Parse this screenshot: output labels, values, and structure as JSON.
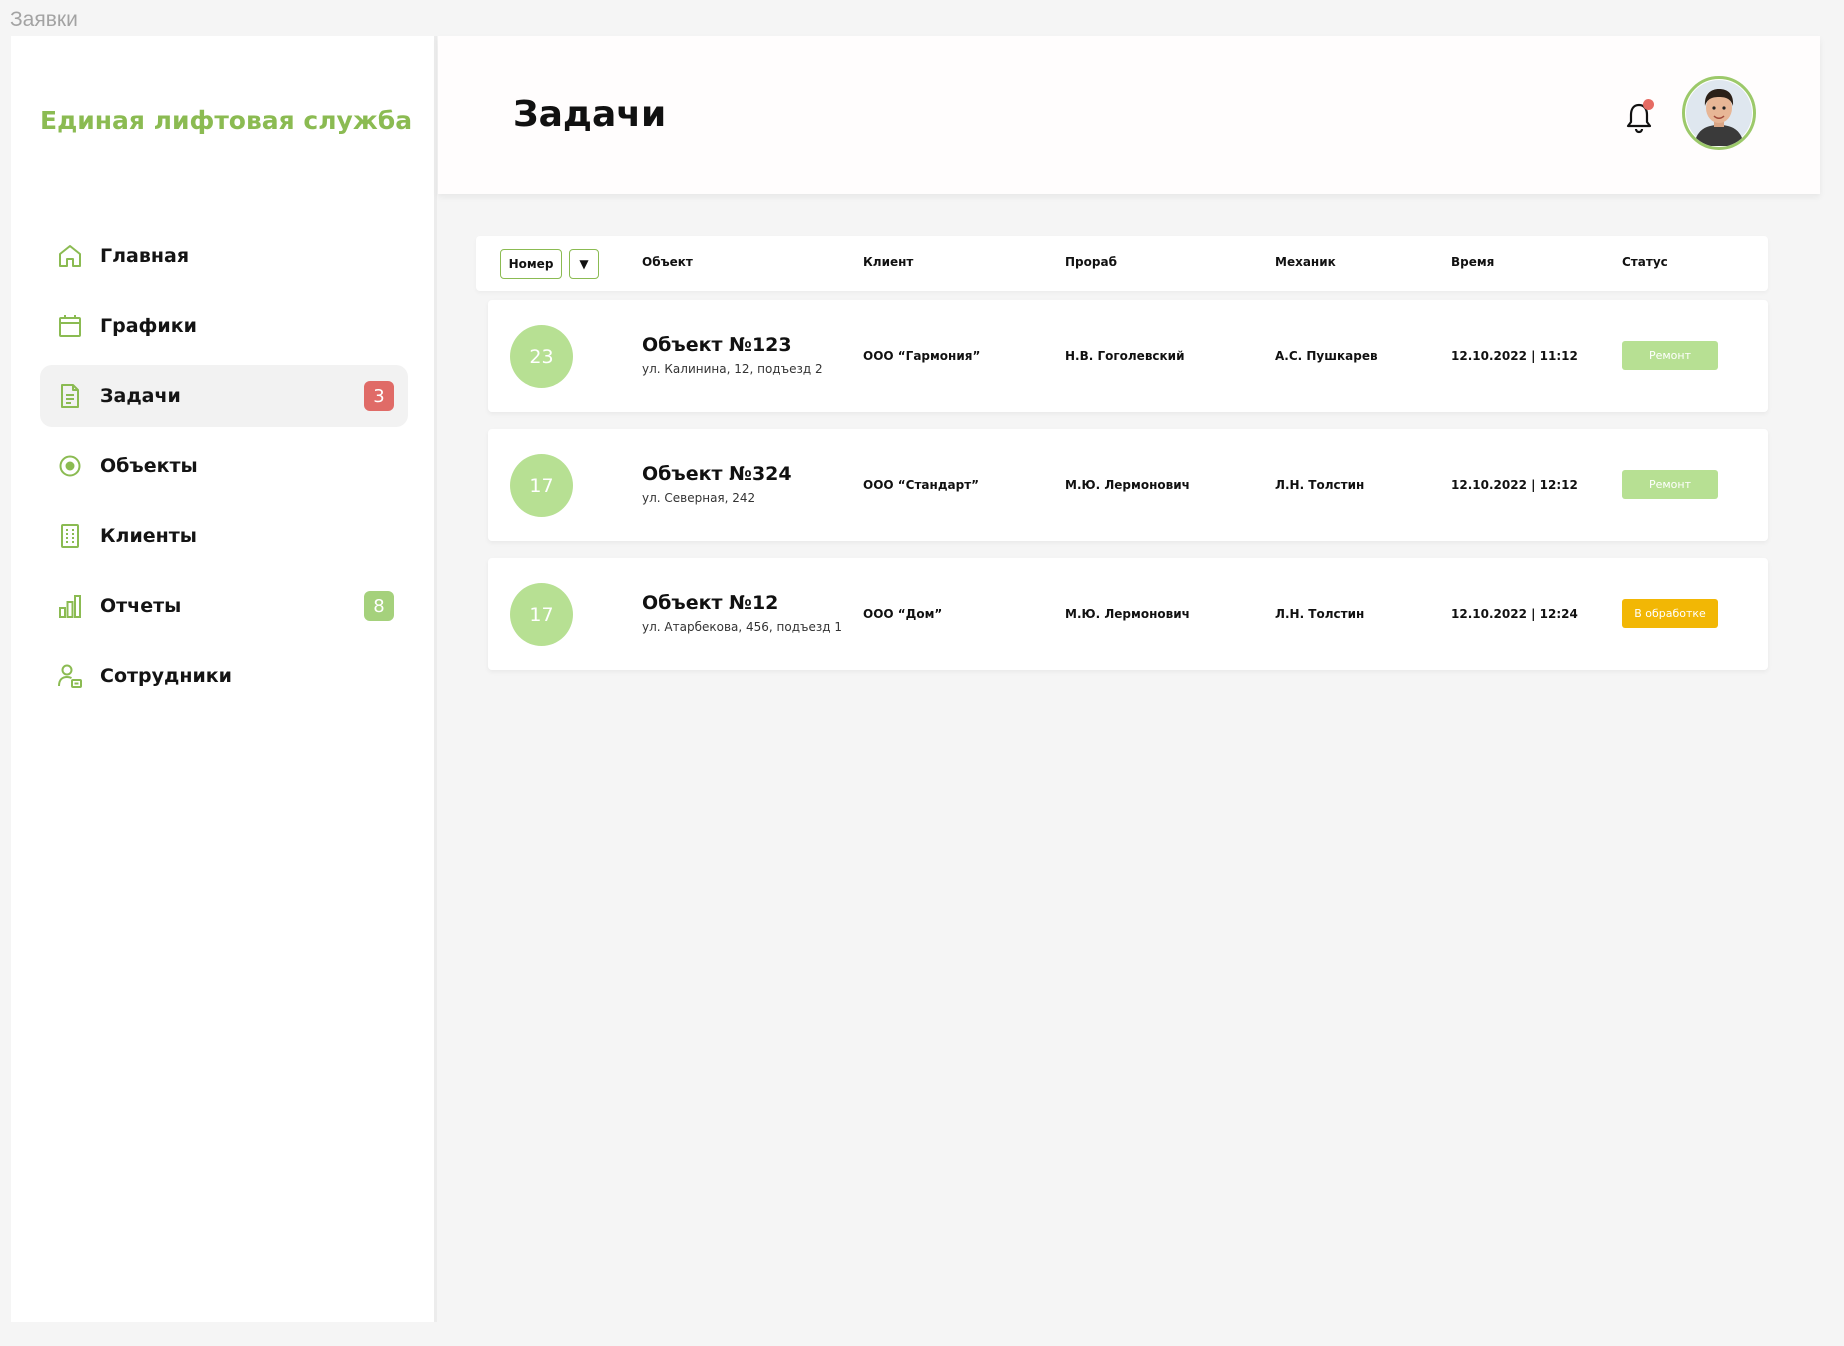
{
  "frame_label": "Заявки",
  "brand": "Единая лифтовая служба",
  "sidebar": {
    "items": [
      {
        "label": "Главная",
        "icon": "home-icon"
      },
      {
        "label": "Графики",
        "icon": "calendar-icon"
      },
      {
        "label": "Задачи",
        "icon": "document-icon",
        "badge": "3",
        "active": true
      },
      {
        "label": "Объекты",
        "icon": "target-icon"
      },
      {
        "label": "Клиенты",
        "icon": "building-icon"
      },
      {
        "label": "Отчеты",
        "icon": "bar-chart-icon",
        "badge": "8"
      },
      {
        "label": "Сотрудники",
        "icon": "employee-icon"
      }
    ]
  },
  "header": {
    "title": "Задачи"
  },
  "table": {
    "sort_field": "Номер",
    "sort_toggle": "▼",
    "columns": [
      "Объект",
      "Клиент",
      "Прораб",
      "Механик",
      "Время",
      "Статус"
    ],
    "rows": [
      {
        "number": "23",
        "object": "Объект №123",
        "address": "ул. Калинина, 12, подъезд 2",
        "client": "ООО “Гармония”",
        "foreman": "Н.В. Гоголевский",
        "mechanic": "А.С. Пушкарев",
        "time": "12.10.2022 | 11:12",
        "status": "Ремонт"
      },
      {
        "number": "17",
        "object": "Объект №324",
        "address": "ул. Северная, 242",
        "client": "ООО “Стандарт”",
        "foreman": "М.Ю. Лермонович",
        "mechanic": "Л.Н. Толстин",
        "time": "12.10.2022 | 12:12",
        "status": "Ремонт"
      },
      {
        "number": "17",
        "object": "Объект №12",
        "address": "ул. Атарбекова, 456, подъезд 1",
        "client": "ООО “Дом”",
        "foreman": "М.Ю. Лермонович",
        "mechanic": "Л.Н. Толстин",
        "time": "12.10.2022 | 12:24",
        "status": "В обработке"
      }
    ]
  },
  "colors": {
    "brand_green": "#8bbb52",
    "circle_green": "#b7e093",
    "status_repair": "#b7e093",
    "status_processing": "#f2b705",
    "badge_red": "#e06b67",
    "badge_green": "#a5d17c"
  }
}
